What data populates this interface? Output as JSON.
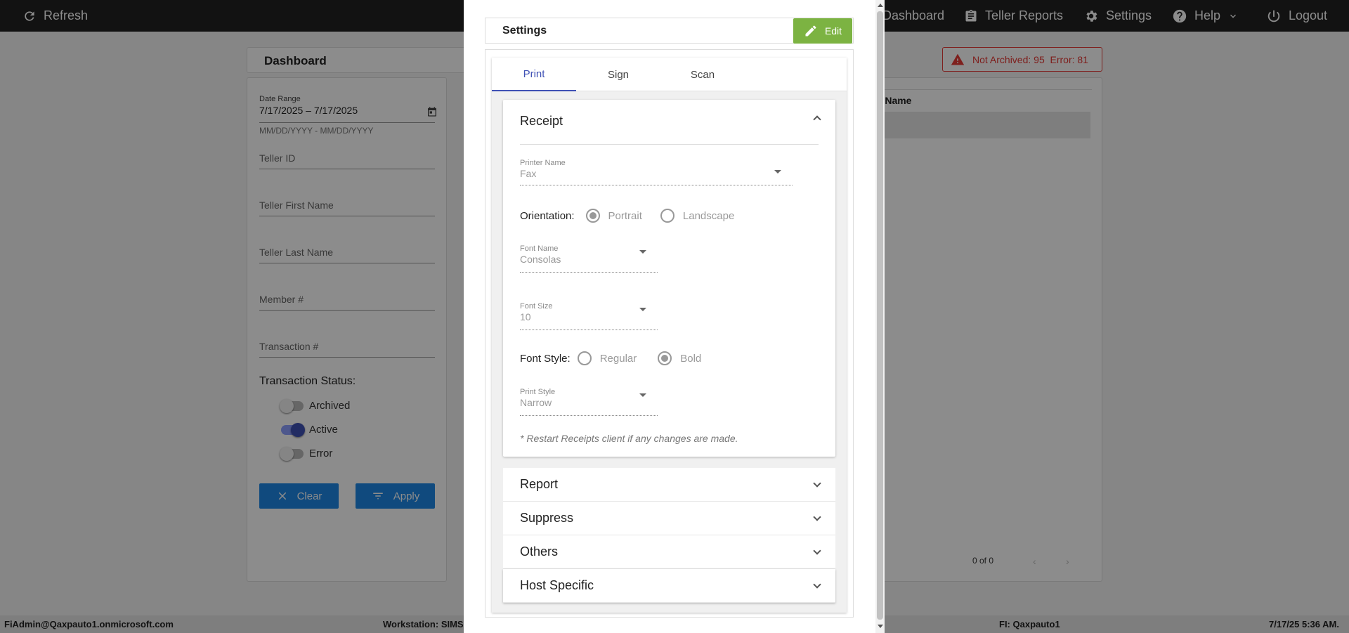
{
  "topbar": {
    "refresh": "Refresh",
    "dashboard": "Dashboard",
    "teller_reports": "Teller Reports",
    "settings": "Settings",
    "help": "Help",
    "logout": "Logout"
  },
  "dashboard": {
    "title": "Dashboard",
    "date_range_label": "Date Range",
    "date_range_value": "7/17/2025 – 7/17/2025",
    "date_range_hint": "MM/DD/YYYY - MM/DD/YYYY",
    "teller_id": "Teller ID",
    "teller_first_name": "Teller First Name",
    "teller_last_name": "Teller Last Name",
    "member": "Member #",
    "transaction": "Transaction #",
    "transaction_status": "Transaction Status:",
    "statuses": [
      {
        "label": "Archived",
        "on": false
      },
      {
        "label": "Active",
        "on": true
      },
      {
        "label": "Error",
        "on": false
      }
    ],
    "clear": "Clear",
    "apply": "Apply"
  },
  "alert": {
    "text": "Not Archived: 95  Error: 81",
    "color": "#e53935"
  },
  "right_panel": {
    "column_header": "r Name",
    "pagination": "0 of 0"
  },
  "statusbar": {
    "user": "FiAdmin@Qaxpauto1.onmicrosoft.com",
    "workstation": "Workstation: SIMS-I",
    "fi": "FI: Qaxpauto1",
    "datetime": "7/17/25 5:36 AM."
  },
  "modal": {
    "title": "Settings",
    "edit": "Edit",
    "tabs": [
      "Print",
      "Sign",
      "Scan"
    ],
    "active_tab": "Print",
    "receipt": {
      "title": "Receipt",
      "printer_name_label": "Printer Name",
      "printer_name_value": "Fax",
      "orientation_label": "Orientation:",
      "orientation_portrait": "Portrait",
      "orientation_landscape": "Landscape",
      "font_name_label": "Font Name",
      "font_name_value": "Consolas",
      "font_size_label": "Font Size",
      "font_size_value": "10",
      "font_style_label": "Font Style:",
      "font_style_regular": "Regular",
      "font_style_bold": "Bold",
      "print_style_label": "Print Style",
      "print_style_value": "Narrow",
      "note": "* Restart Receipts client if any changes are made."
    },
    "sections": [
      "Report",
      "Suppress",
      "Others",
      "Host Specific"
    ]
  },
  "colors": {
    "accent": "#3f51b5",
    "edit_green": "#7cb342",
    "button_blue": "#1e88e5"
  }
}
